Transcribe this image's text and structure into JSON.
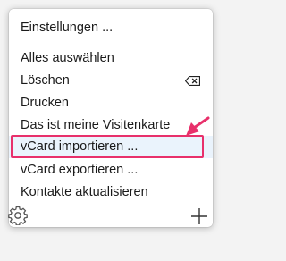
{
  "menu": {
    "items": [
      {
        "label": "Einstellungen ..."
      },
      {
        "label": "Alles auswählen"
      },
      {
        "label": "Löschen"
      },
      {
        "label": "Drucken"
      },
      {
        "label": "Das ist meine Visitenkarte"
      },
      {
        "label": "vCard importieren ..."
      },
      {
        "label": "vCard exportieren ..."
      },
      {
        "label": "Kontakte aktualisieren"
      }
    ],
    "highlighted_item": "vCard importieren ..."
  },
  "icons": {
    "delete_shortcut": "backspace-icon",
    "settings": "gear-icon",
    "add": "plus-icon",
    "annotation": "arrow-icon"
  },
  "colors": {
    "annotation": "#e8306b",
    "highlight": "#eaf3fc",
    "separator": "#d4d4d4"
  }
}
